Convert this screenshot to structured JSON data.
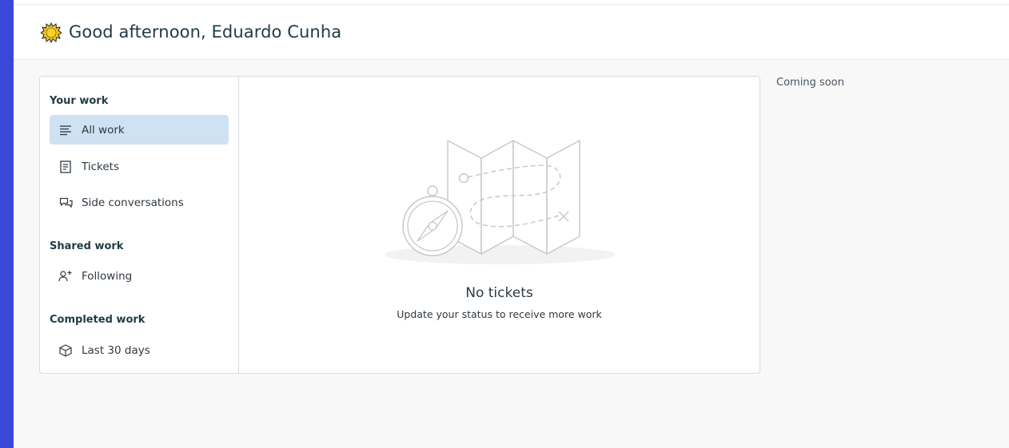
{
  "header": {
    "greeting": "Good afternoon, Eduardo Cunha",
    "greeting_icon": "sun-icon"
  },
  "sidebar": {
    "sections": [
      {
        "title": "Your work",
        "items": [
          {
            "label": "All work",
            "icon": "list-icon",
            "active": true
          },
          {
            "label": "Tickets",
            "icon": "ticket-icon",
            "active": false
          },
          {
            "label": "Side conversations",
            "icon": "conversations-icon",
            "active": false
          }
        ]
      },
      {
        "title": "Shared work",
        "items": [
          {
            "label": "Following",
            "icon": "follow-user-icon",
            "active": false
          }
        ]
      },
      {
        "title": "Completed work",
        "items": [
          {
            "label": "Last 30 days",
            "icon": "box-icon",
            "active": false
          }
        ]
      }
    ]
  },
  "main": {
    "empty_title": "No tickets",
    "empty_subtitle": "Update your status to receive more work",
    "illustration": "map-compass-illustration"
  },
  "aside": {
    "text": "Coming soon"
  },
  "colors": {
    "rail": "#3b47d9",
    "active_item": "#cfe2f3",
    "heading": "#1f3b45"
  }
}
